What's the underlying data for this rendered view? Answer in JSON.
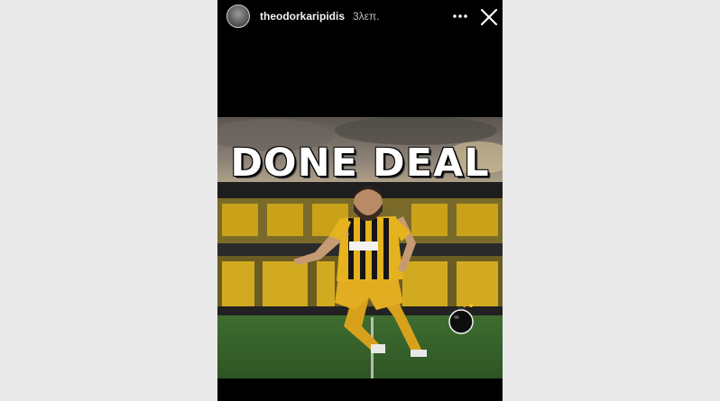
{
  "story": {
    "username": "theodorkaripidis",
    "time_ago": "3λεπ.",
    "headline": "DONE DEAL",
    "icons": {
      "avatar": "profile-avatar",
      "more": "more-options-icon",
      "close": "close-icon",
      "sticker": "bomb-sticker"
    }
  },
  "colors": {
    "kit_yellow": "#e6b31e",
    "kit_black": "#151515",
    "pitch_green": "#3c6b2e",
    "seats_yellow": "#c9a21a"
  }
}
